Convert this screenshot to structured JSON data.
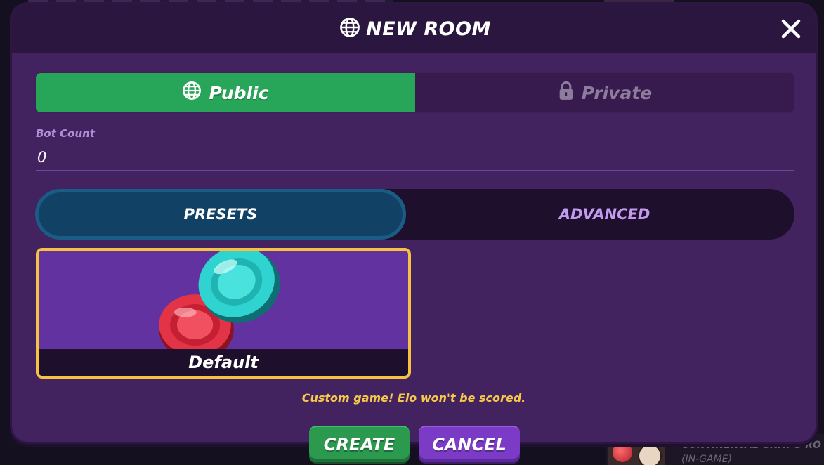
{
  "dialog": {
    "title": "NEW ROOM",
    "title_icon": "globe-icon",
    "close_icon": "close-icon"
  },
  "visibility": {
    "options": [
      {
        "label": "Public",
        "icon": "globe-icon",
        "selected": true
      },
      {
        "label": "Private",
        "icon": "lock-icon",
        "selected": false
      }
    ]
  },
  "bot_count": {
    "label": "Bot Count",
    "value": "0"
  },
  "mode_tabs": [
    {
      "label": "PRESETS",
      "selected": true
    },
    {
      "label": "ADVANCED",
      "selected": false
    }
  ],
  "presets": [
    {
      "label": "Default",
      "selected": true
    }
  ],
  "warning": "Custom game! Elo won't be scored.",
  "buttons": {
    "create": "CREATE",
    "cancel": "CANCEL"
  },
  "background": {
    "card_name": "CONTINENTAL GNAT'S RO",
    "card_status": "(IN-GAME)"
  },
  "colors": {
    "modal_bg": "#42235f",
    "header_bg": "#2b163f",
    "public_green": "#27a65a",
    "presets_tab": "#114265",
    "preset_border": "#f5c242",
    "warning_text": "#f6c74a",
    "create_green": "#2b9a4f",
    "cancel_purple": "#7c3bc6"
  }
}
